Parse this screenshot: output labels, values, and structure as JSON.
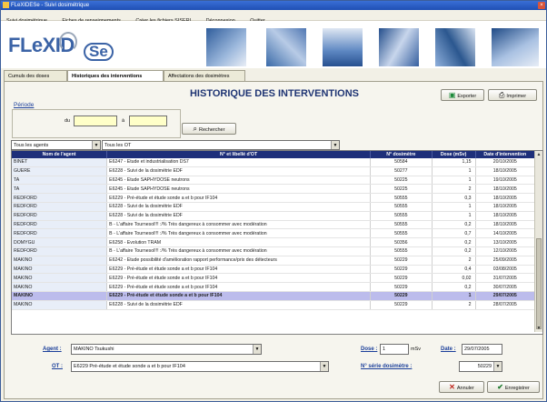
{
  "window": {
    "title": "FLeXIDESe - Suivi dosimétrique"
  },
  "menu": [
    "Suivi dosimétrique",
    "Fiches de renseignements",
    "Créer les fichiers SISERI",
    "Déconnexion",
    "Quitter"
  ],
  "logo": {
    "text": "FLeXID",
    "suffix": "Se"
  },
  "tabs": [
    "Cumuls des doses",
    "Historiques des interventions",
    "Affectations des dosimètres"
  ],
  "page": {
    "title": "HISTORIQUE DES INTERVENTIONS"
  },
  "toolbar": {
    "export_label": "Exporter",
    "print_label": "Imprimer"
  },
  "periode": {
    "label": "Période",
    "from_label": "du",
    "to_label": "à",
    "from_value": "",
    "to_value": "",
    "search_label": "Rechercher"
  },
  "filters": {
    "agents": "Tous les agents",
    "ot": "Tous les OT"
  },
  "grid": {
    "columns": [
      "Nom de l'agent",
      "N° et libellé d'OT",
      "N° dosimètre",
      "Dose (mSv)",
      "Date d'intervention"
    ],
    "rows": [
      [
        "BINET",
        "E6247 - Etude et industrialisation DS7",
        "50584",
        "1,15",
        "20/10/2005"
      ],
      [
        "GUERE",
        "E6228 - Suivi de la dosimétrie EDF",
        "50277",
        "1",
        "18/10/2005"
      ],
      [
        "TA",
        "E6245 - Etude SAPHYDOSE neutrons",
        "50225",
        "1",
        "19/10/2005"
      ],
      [
        "TA",
        "E6245 - Etude SAPHYDOSE neutrons",
        "50225",
        "2",
        "18/10/2005"
      ],
      [
        "REDFORD",
        "E6229 - Pré-étude et étude sonde a et b pour IF104",
        "50555",
        "0,3",
        "18/10/2005"
      ],
      [
        "REDFORD",
        "E6228 - Suivi de la dosimétrie EDF",
        "50555",
        "1",
        "18/10/2005"
      ],
      [
        "REDFORD",
        "E6228 - Suivi de la dosimétrie EDF",
        "50555",
        "1",
        "18/10/2005"
      ],
      [
        "REDFORD",
        "B - L'affaire Tournesol!!! :/% Très dangereux à consommer avec modération",
        "50555",
        "0,2",
        "18/10/2005"
      ],
      [
        "REDFORD",
        "B - L'affaire Tournesol!!! :/% Très dangereux à consommer avec modération",
        "50555",
        "0,7",
        "14/10/2005"
      ],
      [
        "DOMYGU",
        "E6258 - Evolution TRAM",
        "50356",
        "0,2",
        "13/10/2005"
      ],
      [
        "REDFORD",
        "B - L'affaire Tournesol!!! :/% Très dangereux à consommer avec modération",
        "50555",
        "0,2",
        "12/10/2005"
      ],
      [
        "MAKINO",
        "E6242 - Etude possibilité d'amélioration rapport performance/prix des détecteurs",
        "50229",
        "2",
        "25/09/2005"
      ],
      [
        "MAKINO",
        "E6229 - Pré-étude et étude sonde a et b pour IF104",
        "50229",
        "0,4",
        "03/08/2005"
      ],
      [
        "MAKINO",
        "E6229 - Pré-étude et étude sonde a et b pour IF104",
        "50229",
        "0,02",
        "31/07/2005"
      ],
      [
        "MAKINO",
        "E6229 - Pré-étude et étude sonde a et b pour IF104",
        "50229",
        "0,2",
        "30/07/2005"
      ],
      [
        "MAKINO",
        "E6229 - Pré-étude et étude sonde a et b pour IF104",
        "50229",
        "1",
        "29/07/2005"
      ],
      [
        "MAKINO",
        "E6228 - Suivi de la dosimétrie EDF",
        "50229",
        "2",
        "28/07/2005"
      ]
    ],
    "selected_row": 15
  },
  "form": {
    "agent_label": "Agent :",
    "agent_value": "MAKINO Tsukushi",
    "ot_label": "OT :",
    "ot_value": "E6229 Pré-étude et étude sonde a et b pour IF104",
    "dose_label": "Dose :",
    "dose_value": "1",
    "dose_unit": "mSv",
    "date_label": "Date :",
    "date_value": "29/07/2005",
    "serial_label": "N° série dosimètre :",
    "serial_value": "50229",
    "cancel_label": "Annuler",
    "save_label": "Enregistrer"
  }
}
